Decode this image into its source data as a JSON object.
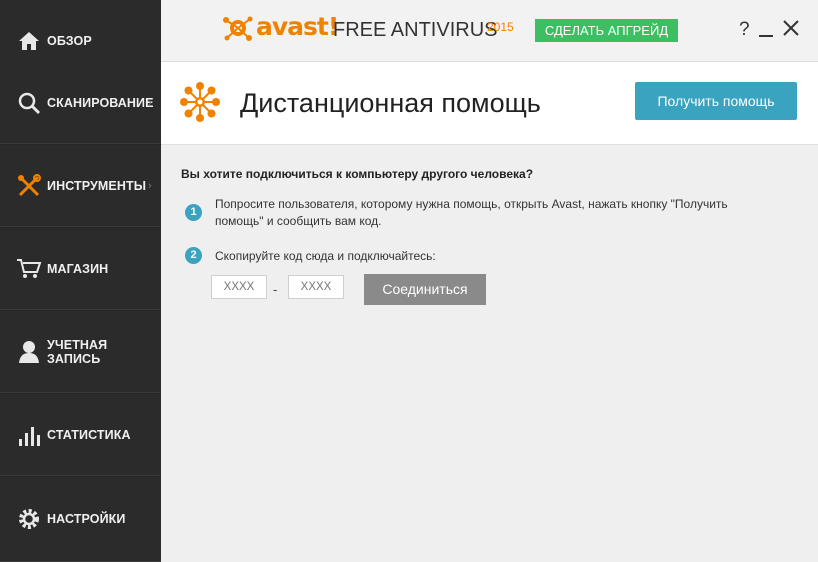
{
  "sidebar": {
    "items": [
      {
        "label": "ОБЗОР",
        "icon": "home-icon"
      },
      {
        "label": "СКАНИРОВАНИЕ",
        "icon": "magnifier-icon",
        "chevron": "›"
      },
      {
        "label": "ИНСТРУМЕНТЫ",
        "icon": "tools-icon",
        "chevron": "›"
      },
      {
        "label": "МАГАЗИН",
        "icon": "cart-icon"
      },
      {
        "label": "УЧЕТНАЯ ЗАПИСЬ",
        "icon": "user-icon"
      },
      {
        "label": "СТАТИСТИКА",
        "icon": "stats-icon"
      },
      {
        "label": "НАСТРОЙКИ",
        "icon": "gear-icon"
      }
    ]
  },
  "titlebar": {
    "logo": "avast!",
    "product": "FREE ANTIVIRUS",
    "year": "2015",
    "upgrade_label": "СДЕЛАТЬ АПГРЕЙД",
    "help_label": "?"
  },
  "header": {
    "title": "Дистанционная помощь",
    "get_help_label": "Получить помощь"
  },
  "content": {
    "question": "Вы хотите подключиться к компьютеру другого человека?",
    "step1": {
      "num": "1",
      "text": "Попросите пользователя, которому нужна помощь, открыть Avast, нажать кнопку \"Получить помощь\" и сообщить вам код."
    },
    "step2": {
      "num": "2",
      "text": "Скопируйте код сюда и подключайтесь:"
    },
    "code1_placeholder": "XXXX",
    "code2_placeholder": "XXXX",
    "dash": "-",
    "connect_label": "Соединиться"
  },
  "colors": {
    "accent_orange": "#f08200",
    "upgrade_green": "#3cbf63",
    "primary_blue": "#3aa3c0",
    "sidebar_bg": "#2b2b2b"
  }
}
